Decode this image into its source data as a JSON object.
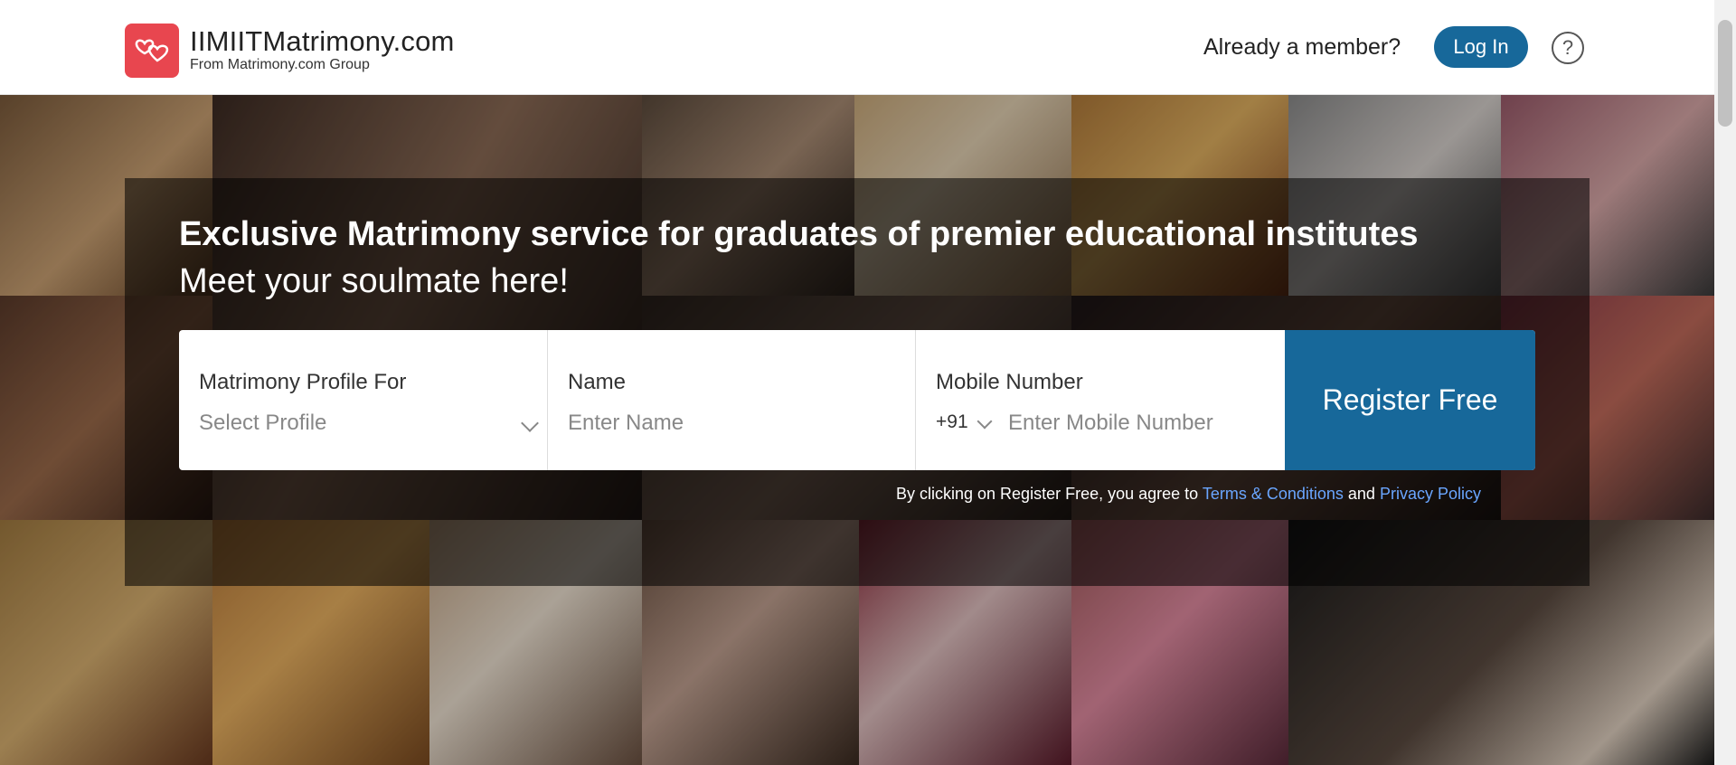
{
  "header": {
    "brand_name": "IIMIITMatrimony.com",
    "brand_sub": "From Matrimony.com Group",
    "already_member": "Already a member?",
    "login_label": "Log In",
    "help_glyph": "?"
  },
  "hero": {
    "headline": "Exclusive Matrimony service for graduates of premier educational institutes",
    "subline": "Meet your soulmate here!"
  },
  "form": {
    "profile_label": "Matrimony Profile For",
    "profile_value": "Select Profile",
    "name_label": "Name",
    "name_placeholder": "Enter Name",
    "mobile_label": "Mobile Number",
    "country_code": "+91",
    "mobile_placeholder": "Enter Mobile Number",
    "register_label": "Register Free"
  },
  "terms": {
    "prefix": "By clicking on Register Free, you agree to ",
    "terms_link": "Terms & Conditions",
    "and": " and ",
    "privacy_link": "Privacy Policy"
  },
  "colors": {
    "brand_red": "#e8464f",
    "primary_blue": "#17689a",
    "link_blue": "#6aa6ff"
  },
  "icons": {
    "logo": "hearts-logo-icon",
    "help": "help-circle-icon",
    "dropdown": "chevron-down-icon"
  }
}
